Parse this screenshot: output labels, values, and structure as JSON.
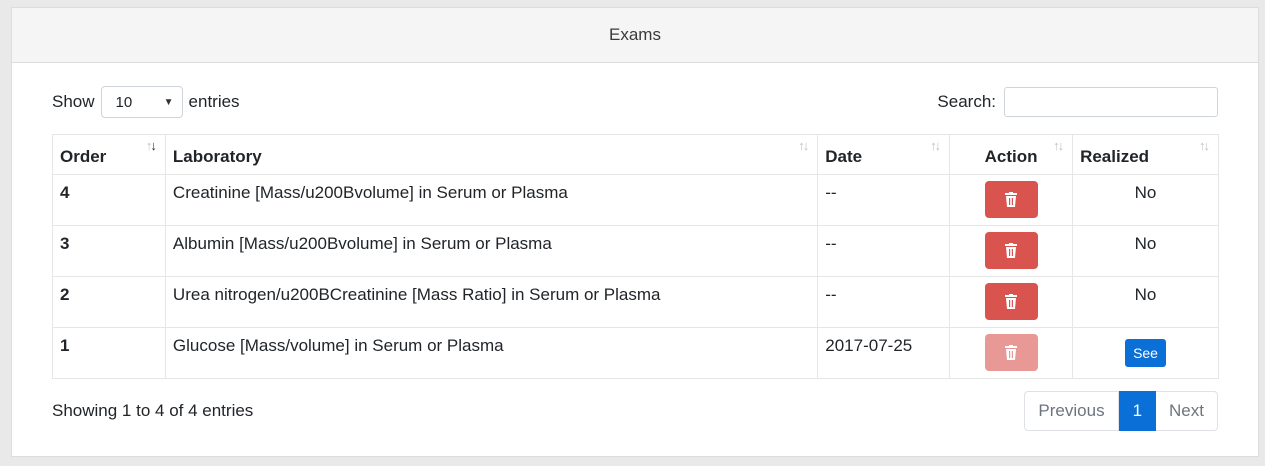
{
  "card": {
    "title": "Exams"
  },
  "controls": {
    "show_label": "Show",
    "entries_value": "10",
    "entries_label": "entries",
    "search_label": "Search:",
    "search_value": ""
  },
  "table": {
    "headers": {
      "order": "Order",
      "laboratory": "Laboratory",
      "date": "Date",
      "action": "Action",
      "realized": "Realized"
    },
    "rows": [
      {
        "order": "4",
        "laboratory": "Creatinine [Mass/u200Bvolume] in Serum or Plasma",
        "date": "--",
        "realized": "No"
      },
      {
        "order": "3",
        "laboratory": "Albumin [Mass/u200Bvolume] in Serum or Plasma",
        "date": "--",
        "realized": "No"
      },
      {
        "order": "2",
        "laboratory": "Urea nitrogen/u200BCreatinine [Mass Ratio] in Serum or Plasma",
        "date": "--",
        "realized": "No"
      },
      {
        "order": "1",
        "laboratory": "Glucose [Mass/volume] in Serum or Plasma",
        "date": "2017-07-25",
        "realized": "See"
      }
    ]
  },
  "footer": {
    "info": "Showing 1 to 4 of 4 entries",
    "prev": "Previous",
    "page": "1",
    "next": "Next"
  },
  "colors": {
    "primary": "#0a6fd6",
    "danger": "#d9534f",
    "danger_disabled": "#e89996"
  },
  "icons": {
    "delete": "trash-icon",
    "sort": "sort-icon"
  }
}
